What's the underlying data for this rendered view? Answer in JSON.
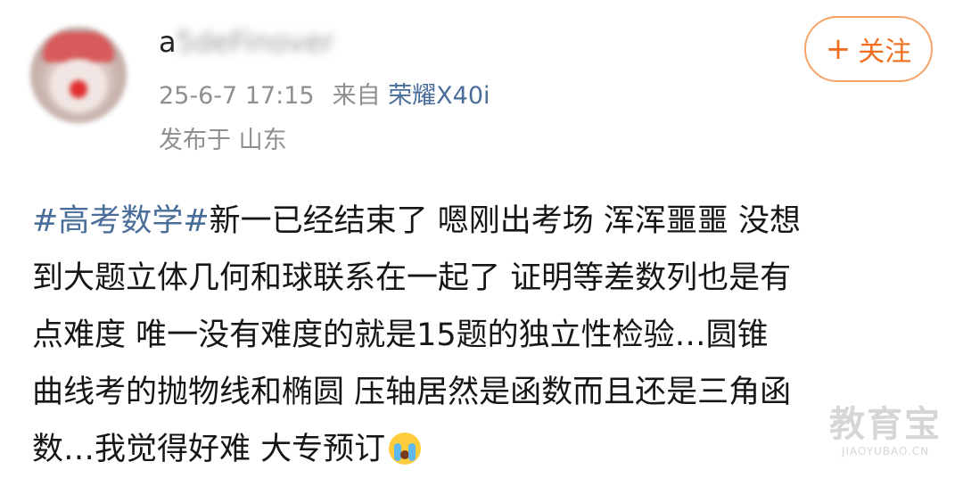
{
  "user": {
    "name_first": "a",
    "name_rest": "5deFinover",
    "timestamp": "25-6-7 17:15",
    "source_label": "来自",
    "device": "荣耀X40i",
    "location": "发布于 山东"
  },
  "follow_button": {
    "plus": "+",
    "label": "关注"
  },
  "post": {
    "hashtag": "#高考数学#",
    "line1_rest": "新一已经结束了 嗯刚出考场 浑浑噩噩 没想",
    "line2": "到大题立体几何和球联系在一起了 证明等差数列也是有",
    "line3": "点难度 唯一没有难度的就是15题的独立性检验…圆锥",
    "line4": "曲线考的抛物线和椭圆 压轴居然是函数而且还是三角函",
    "line5": "数…我觉得好难 大专预订",
    "emoji": "crying-face-icon"
  },
  "watermark": {
    "main": "教育宝",
    "sub": "JIAOYUBAO.CN"
  },
  "colors": {
    "link": "#4a6d9a",
    "follow_accent": "#f06e1e",
    "meta_gray": "#8f8f8f"
  }
}
